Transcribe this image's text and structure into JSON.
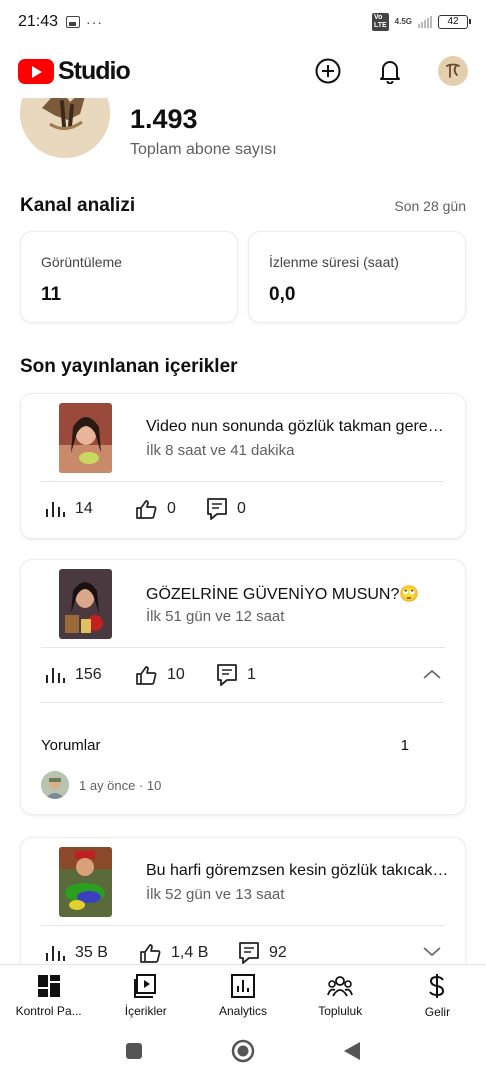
{
  "status_bar": {
    "time": "21:43",
    "dots": "···",
    "network_type": "4.5G",
    "volte": "VoLTE",
    "battery": "42"
  },
  "header": {
    "brand": "Studio",
    "icons": [
      "create-icon",
      "notifications-icon",
      "account-avatar"
    ]
  },
  "channel": {
    "subscriber_count": "1.493",
    "subscriber_label": "Toplam abone sayısı"
  },
  "analytics": {
    "title": "Kanal analizi",
    "period": "Son 28 gün",
    "cards": [
      {
        "label": "Görüntüleme",
        "value": "11"
      },
      {
        "label": "İzlenme süresi (saat)",
        "value": "0,0"
      }
    ]
  },
  "recent": {
    "title": "Son yayınlanan içerikler",
    "videos": [
      {
        "title": "Video nun sonunda gözlük takman gerekebilir",
        "age": "İlk 8 saat ve 41 dakika",
        "views": "14",
        "likes": "0",
        "comments": "0"
      },
      {
        "title": "GÖZELRİNE GÜVENİYO MUSUN?🙄",
        "age": "İlk 51 gün ve 12 saat",
        "views": "156",
        "likes": "10",
        "comments": "1",
        "expanded": true,
        "comments_section": {
          "label": "Yorumlar",
          "count": "1",
          "latest_meta": "1 ay önce · 10"
        }
      },
      {
        "title": "Bu harfi göremzsen kesin gözlük takıcaksın",
        "age": "İlk 52 gün ve 13 saat",
        "views": "35 B",
        "likes": "1,4 B",
        "comments": "92"
      }
    ]
  },
  "bottom_nav": [
    {
      "label": "Kontrol Pa...",
      "icon": "dashboard-icon"
    },
    {
      "label": "İçerikler",
      "icon": "content-icon"
    },
    {
      "label": "Analytics",
      "icon": "analytics-icon"
    },
    {
      "label": "Topluluk",
      "icon": "community-icon"
    },
    {
      "label": "Gelir",
      "icon": "earn-icon"
    }
  ],
  "colors": {
    "brand_red": "#ff0000",
    "secondary_text": "#606060"
  }
}
